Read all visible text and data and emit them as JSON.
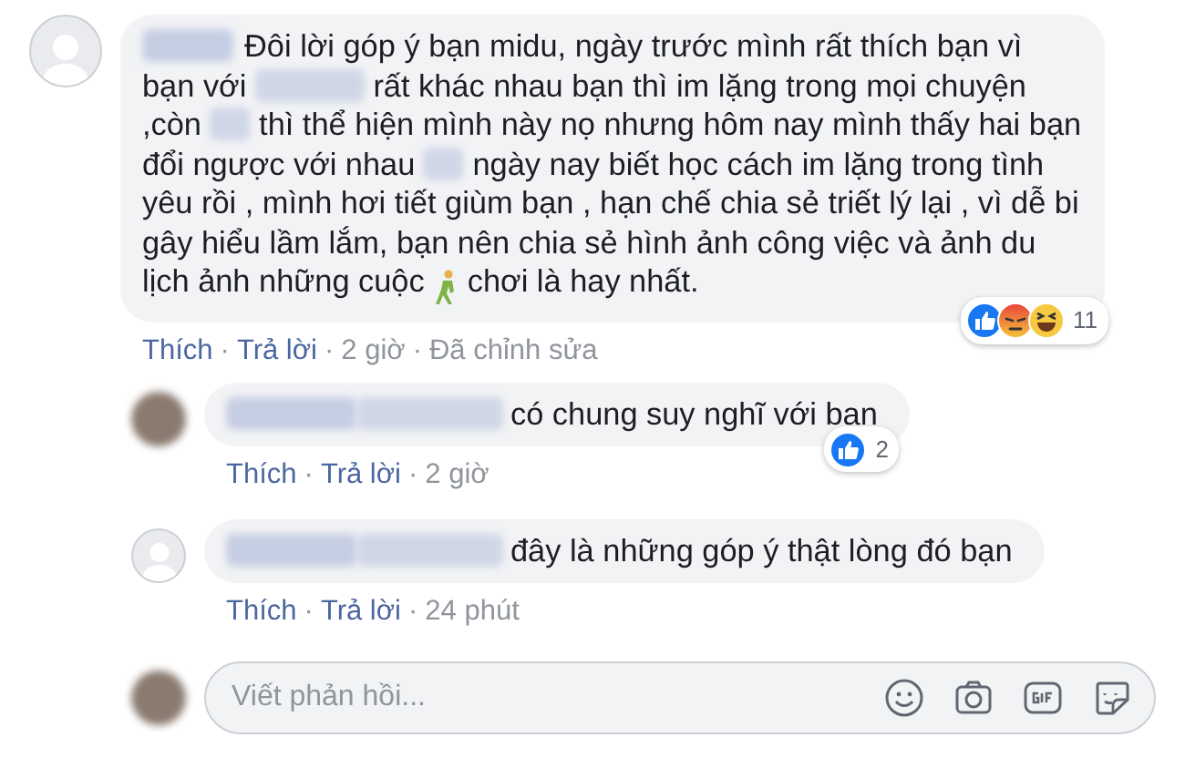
{
  "comment": {
    "avatar": {
      "kind": "silhouette"
    },
    "body": [
      {
        "kind": "name"
      },
      {
        "kind": "text",
        "text": "Đôi lời góp ý bạn midu, ngày trước mình rất thích bạn vì bạn với "
      },
      {
        "kind": "longblur"
      },
      {
        "kind": "text",
        "text": " rất khác nhau bạn thì im lặng trong mọi chuyện ,còn "
      },
      {
        "kind": "shortblur"
      },
      {
        "kind": "text",
        "text": " thì thể hiện mình này nọ nhưng hôm nay mình thấy hai bạn đổi ngược với nhau "
      },
      {
        "kind": "shortblur"
      },
      {
        "kind": "text",
        "text": " ngày nay biết học cách im lặng trong tình yêu rồi , mình hơi tiết giùm bạn , hạn chế chia sẻ triết lý lại , vì dễ bi gây hiểu lầm lắm, bạn nên chia sẻ hình ảnh công việc và ảnh du lịch ảnh những cuộc "
      },
      {
        "kind": "emoji"
      },
      {
        "kind": "text",
        "text": " chơi là hay nhất."
      }
    ],
    "reactions": {
      "types": [
        {
          "kind": "like"
        },
        {
          "kind": "angry"
        },
        {
          "kind": "haha"
        }
      ],
      "count": "11"
    },
    "actions": [
      {
        "kind": "link",
        "text": "Thích"
      },
      {
        "kind": "sep",
        "text": "·"
      },
      {
        "kind": "link",
        "text": "Trả lời"
      },
      {
        "kind": "sep",
        "text": "·"
      },
      {
        "kind": "meta",
        "text": "2 giờ"
      },
      {
        "kind": "sep",
        "text": "·"
      },
      {
        "kind": "meta",
        "text": "Đã chỉnh sửa"
      }
    ],
    "replies": [
      {
        "avatar": {
          "kind": "photo"
        },
        "text": "có chung suy nghĩ với bạn",
        "reactions": {
          "types": [
            {
              "kind": "like"
            }
          ],
          "count": "2"
        },
        "actions": [
          {
            "kind": "link",
            "text": "Thích"
          },
          {
            "kind": "sep",
            "text": "·"
          },
          {
            "kind": "link",
            "text": "Trả lời"
          },
          {
            "kind": "sep",
            "text": "·"
          },
          {
            "kind": "meta",
            "text": "2 giờ"
          }
        ]
      },
      {
        "avatar": {
          "kind": "silhouette"
        },
        "text": "đây là những góp ý thật lòng đó bạn",
        "actions": [
          {
            "kind": "link",
            "text": "Thích"
          },
          {
            "kind": "sep",
            "text": "·"
          },
          {
            "kind": "link",
            "text": "Trả lời"
          },
          {
            "kind": "sep",
            "text": "·"
          },
          {
            "kind": "meta",
            "text": "24 phút"
          }
        ]
      }
    ]
  },
  "reply_box": {
    "placeholder": "Viết phản hồi..."
  }
}
